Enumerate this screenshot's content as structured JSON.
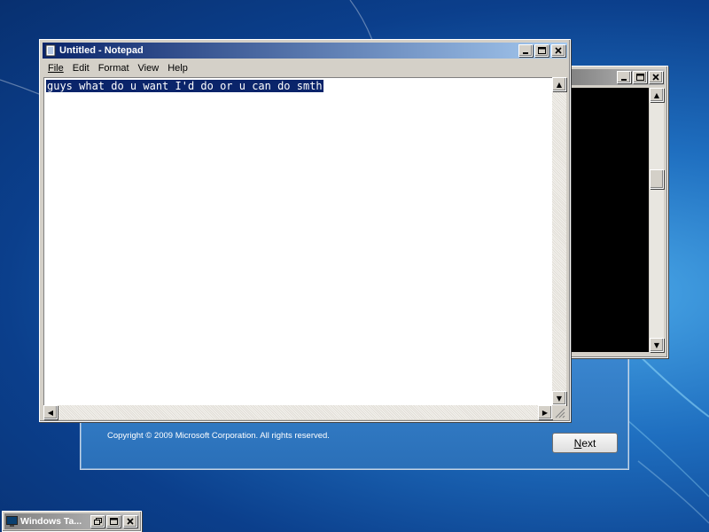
{
  "notepad": {
    "title": "Untitled - Notepad",
    "menus": [
      "File",
      "Edit",
      "Format",
      "View",
      "Help"
    ],
    "content": "guys what do u want I'd do or u can do smth"
  },
  "console": {
    "title": ""
  },
  "setup": {
    "copyright": "Copyright © 2009 Microsoft Corporation. All rights reserved.",
    "next_label_first": "N",
    "next_label_rest": "ext"
  },
  "taskbar": {
    "minimized_title": "Windows Ta..."
  },
  "icons": {
    "minimize": "minimize-icon",
    "maximize": "maximize-icon",
    "restore": "restore-icon",
    "close": "close-icon"
  },
  "colors": {
    "title_active": "#0a246a",
    "selection": "#0a246a",
    "desktop": "#1f6fc0"
  }
}
